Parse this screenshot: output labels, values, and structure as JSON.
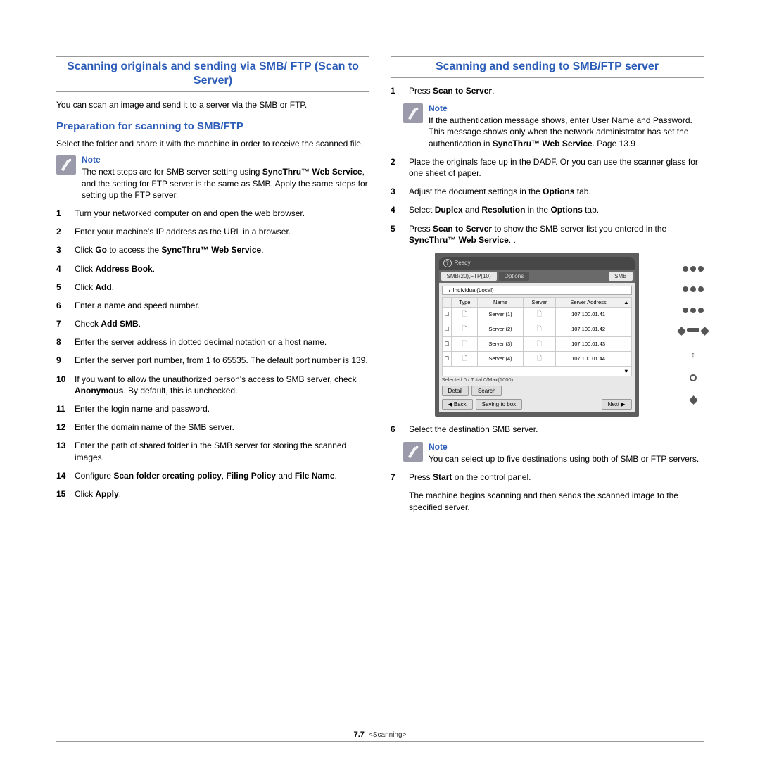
{
  "left": {
    "heading": "Scanning originals and sending via SMB/ FTP (Scan to Server)",
    "intro": "You can scan an image and send it to a server via the SMB or FTP.",
    "sub1": "Preparation for scanning to SMB/FTP",
    "sub1_intro": "Select the folder and share it with the machine in order to receive the scanned file.",
    "note_label": "Note",
    "note_text_pre": "The next steps are for SMB server setting using ",
    "note_bold1": "SyncThru™ Web Service",
    "note_text_post": ", and the setting for FTP server is the same as SMB. Apply the same steps for setting up the FTP server.",
    "steps": [
      {
        "n": "1",
        "plain": "Turn your networked computer on and open the web browser."
      },
      {
        "n": "2",
        "plain": "Enter your machine's IP address as the URL in a browser."
      },
      {
        "n": "3",
        "parts": [
          {
            "t": "Click "
          },
          {
            "b": "Go"
          },
          {
            "t": " to access the "
          },
          {
            "b": "SyncThru™ Web Service"
          },
          {
            "t": "."
          }
        ]
      },
      {
        "n": "4",
        "parts": [
          {
            "t": "Click "
          },
          {
            "b": "Address Book"
          },
          {
            "t": "."
          }
        ]
      },
      {
        "n": "5",
        "parts": [
          {
            "t": "Click "
          },
          {
            "b": "Add"
          },
          {
            "t": "."
          }
        ]
      },
      {
        "n": "6",
        "plain": "Enter a name and speed number."
      },
      {
        "n": "7",
        "parts": [
          {
            "t": "Check "
          },
          {
            "b": "Add SMB"
          },
          {
            "t": "."
          }
        ]
      },
      {
        "n": "8",
        "plain": "Enter the server address in dotted decimal notation or a host name."
      },
      {
        "n": "9",
        "plain": "Enter the server port number, from 1 to 65535. The default port number is 139."
      },
      {
        "n": "10",
        "parts": [
          {
            "t": "If you want to allow the unauthorized person's access to SMB server, check "
          },
          {
            "b": "Anonymous"
          },
          {
            "t": ". By default, this is unchecked."
          }
        ]
      },
      {
        "n": "11",
        "plain": "Enter the login name and password."
      },
      {
        "n": "12",
        "plain": "Enter the domain name of the SMB server."
      },
      {
        "n": "13",
        "plain": "Enter the path of shared folder in the SMB server for storing the scanned images."
      },
      {
        "n": "14",
        "parts": [
          {
            "t": "Configure "
          },
          {
            "b": "Scan folder creating policy"
          },
          {
            "t": ", "
          },
          {
            "b": "Filing Policy"
          },
          {
            "t": " and "
          },
          {
            "b": "File Name"
          },
          {
            "t": "."
          }
        ]
      },
      {
        "n": "15",
        "parts": [
          {
            "t": "Click "
          },
          {
            "b": "Apply"
          },
          {
            "t": "."
          }
        ]
      }
    ]
  },
  "right": {
    "heading": "Scanning and sending to SMB/FTP server",
    "note_label": "Note",
    "steps_pre": [
      {
        "n": "1",
        "parts": [
          {
            "t": "Press "
          },
          {
            "b": "Scan to Server"
          },
          {
            "t": "."
          }
        ]
      }
    ],
    "note1_text_pre": " If the authentication message shows, enter User Name and Password. This message shows only when the network administrator has set the authentication in ",
    "note1_bold": "SyncThru™ Web Service",
    "note1_text_post": ". Page 13.9",
    "steps_mid": [
      {
        "n": "2",
        "plain": "Place the originals face up in the DADF. Or you can use the scanner glass for one sheet of paper."
      },
      {
        "n": "3",
        "parts": [
          {
            "t": "Adjust the document settings in the "
          },
          {
            "b": "Options"
          },
          {
            "t": " tab."
          }
        ]
      },
      {
        "n": "4",
        "parts": [
          {
            "t": "Select "
          },
          {
            "b": "Duplex"
          },
          {
            "t": " and "
          },
          {
            "b": "Resolution"
          },
          {
            "t": " in the "
          },
          {
            "b": "Options"
          },
          {
            "t": " tab."
          }
        ]
      },
      {
        "n": "5",
        "parts": [
          {
            "t": "Press "
          },
          {
            "b": "Scan to Server"
          },
          {
            "t": " to show the SMB server list you entered in the "
          },
          {
            "b": "SyncThru™ Web Service"
          },
          {
            "t": ". ."
          }
        ]
      }
    ],
    "screenshot": {
      "ready": "Ready",
      "tab_left": "SMB(20),FTP(10)",
      "tab_right": "Options",
      "send_btn": "SMB",
      "dropdown": "Individual(Local)",
      "col_type": "Type",
      "col_name": "Name",
      "col_server": "Server",
      "col_addr": "Server Address",
      "rows": [
        {
          "name": "Server (1)",
          "addr": "107.100.01.41"
        },
        {
          "name": "Server (2)",
          "addr": "107.100.01.42"
        },
        {
          "name": "Server (3)",
          "addr": "107.100.01.43"
        },
        {
          "name": "Server (4)",
          "addr": "107.100.01.44"
        }
      ],
      "status": "Selected:0 / Total:0/Max(1000)",
      "btn_detail": "Detail",
      "btn_search": "Search",
      "btn_back": "◀ Back",
      "btn_saving": "Saving to box",
      "btn_next": "Next ▶"
    },
    "step6": {
      "n": "6",
      "plain": "Select the destination SMB server."
    },
    "note2_text": "You can select up to five destinations using both of SMB or FTP servers.",
    "step7": {
      "n": "7",
      "parts": [
        {
          "t": "Press "
        },
        {
          "b": "Start"
        },
        {
          "t": " on the control panel."
        }
      ]
    },
    "closing": "The machine begins scanning and then sends the scanned image to the specified server."
  },
  "footer": {
    "page": "7.7",
    "section": "<Scanning>"
  }
}
